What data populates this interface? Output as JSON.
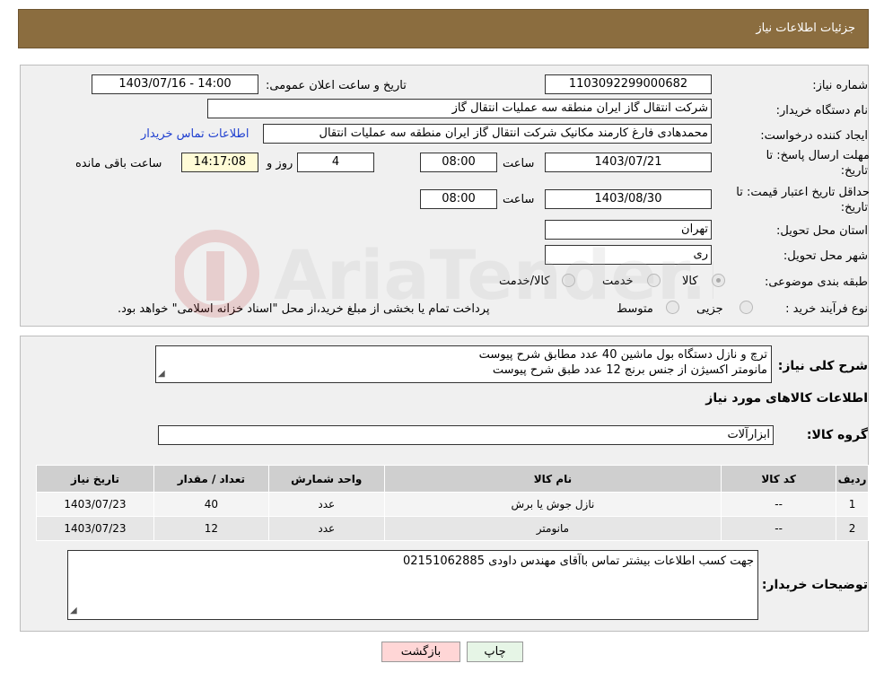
{
  "header": {
    "title": "جزئیات اطلاعات نیاز"
  },
  "form": {
    "need_number_label": "شماره نیاز:",
    "need_number": "1103092299000682",
    "announce_label": "تاریخ و ساعت اعلان عمومی:",
    "announce_value": "1403/07/16 - 14:00",
    "buyer_org_label": "نام دستگاه خریدار:",
    "buyer_org": "شرکت انتقال گاز ایران منطقه سه عملیات انتقال گاز",
    "creator_label": "ایجاد کننده درخواست:",
    "creator": "محمدهادی فارغ کارمند مکانیک شرکت انتقال گاز ایران منطقه سه عملیات انتقال",
    "buyer_contact_link": "اطلاعات تماس خریدار",
    "deadline_label_1": "مهلت ارسال پاسخ: تا",
    "deadline_label_2": "تاریخ:",
    "deadline_date": "1403/07/21",
    "time_label": "ساعت",
    "deadline_time": "08:00",
    "days_value": "4",
    "days_label": "روز و",
    "remaining_time": "14:17:08",
    "remaining_label": "ساعت باقی مانده",
    "validity_label_1": "حداقل تاریخ اعتبار قیمت: تا",
    "validity_label_2": "تاریخ:",
    "validity_date": "1403/08/30",
    "validity_time": "08:00",
    "province_label": "استان محل تحویل:",
    "province": "تهران",
    "city_label": "شهر محل تحویل:",
    "city": "ری",
    "category_label": "طبقه بندی موضوعی:",
    "category_options": [
      "کالا",
      "خدمت",
      "کالا/خدمت"
    ],
    "category_selected": "کالا",
    "process_label": "نوع فرآیند خرید :",
    "process_options": [
      "جزیی",
      "متوسط"
    ],
    "process_note": "پرداخت تمام یا بخشی از مبلغ خرید،از محل \"اسناد خزانه اسلامی\" خواهد بود."
  },
  "details": {
    "description_label": "شرح کلی نیاز:",
    "description_lines": [
      "ترچ و نازل دستگاه بول ماشین 40 عدد مطابق شرح پیوست",
      "مانومتر اکسیژن از جنس برنج 12 عدد طبق شرح پیوست"
    ],
    "goods_info_title": "اطلاعات کالاهای مورد نیاز",
    "goods_group_label": "گروه کالا:",
    "goods_group": "ابزارآلات",
    "table_headers": [
      "ردیف",
      "کد کالا",
      "نام کالا",
      "واحد شمارش",
      "تعداد / مقدار",
      "تاریخ نیاز"
    ],
    "rows": [
      [
        "1",
        "--",
        "نازل جوش یا برش",
        "عدد",
        "40",
        "1403/07/23"
      ],
      [
        "2",
        "--",
        "مانومتر",
        "عدد",
        "12",
        "1403/07/23"
      ]
    ],
    "buyer_notes_label": "توضیحات خریدار:",
    "buyer_notes": "جهت کسب اطلاعات بیشتر تماس باآقای مهندس داودی 02151062885"
  },
  "buttons": {
    "print": "چاپ",
    "back": "بازگشت"
  },
  "watermark": "AriaTender.neT",
  "colors": {
    "header": "#8b6d3f",
    "back_button": "#ffd6d6",
    "print_button": "#e6f5e6",
    "link": "#2040d0"
  },
  "icons": {
    "grip": "resize-grip-icon",
    "watermark_logo": "aria-tender-logo"
  }
}
